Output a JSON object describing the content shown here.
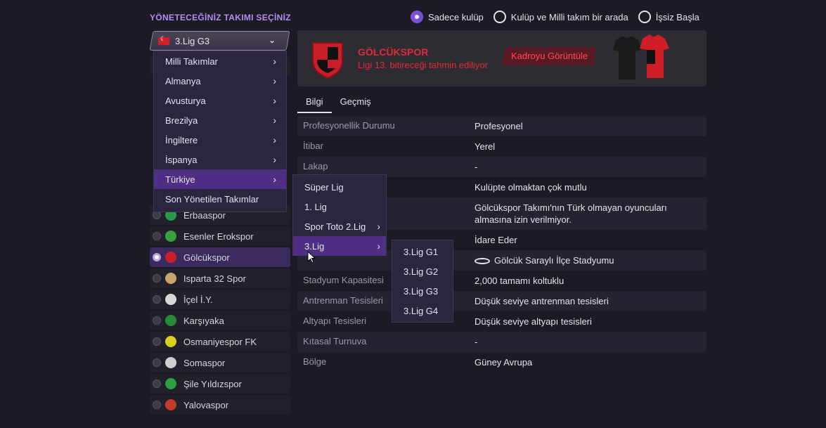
{
  "heading": "YÖNETECEĞİNİZ TAKIMI SEÇİNİZ",
  "radios": [
    {
      "label": "Sadece kulüp",
      "selected": true
    },
    {
      "label": "Kulüp ve Milli takım bir arada",
      "selected": false
    },
    {
      "label": "İşsiz Başla",
      "selected": false
    }
  ],
  "dropdown": {
    "value": "3.Lig G3"
  },
  "menu_level1": [
    {
      "label": "Milli Takımlar"
    },
    {
      "label": "Almanya"
    },
    {
      "label": "Avusturya"
    },
    {
      "label": "Brezilya"
    },
    {
      "label": "İngiltere"
    },
    {
      "label": "İspanya"
    },
    {
      "label": "Türkiye"
    },
    {
      "label": "Son Yönetilen Takımlar"
    }
  ],
  "menu_level2": [
    {
      "label": "Süper Lig"
    },
    {
      "label": "1. Lig"
    },
    {
      "label": "Spor Toto 2.Lig"
    },
    {
      "label": "3.Lig"
    }
  ],
  "menu_level3": [
    {
      "label": "3.Lig G1"
    },
    {
      "label": "3.Lig G2"
    },
    {
      "label": "3.Lig G3"
    },
    {
      "label": "3.Lig G4"
    }
  ],
  "teams": [
    {
      "name": "Erbaaspor",
      "color": "#2a9a4a"
    },
    {
      "name": "Esenler Erokspor",
      "color": "#3aa03a"
    },
    {
      "name": "Gölcükspor",
      "color": "#c81e2a"
    },
    {
      "name": "Isparta 32 Spor",
      "color": "#c9a36a"
    },
    {
      "name": "İçel İ.Y.",
      "color": "#d8d8d8"
    },
    {
      "name": "Karşıyaka",
      "color": "#2a8a3a"
    },
    {
      "name": "Osmaniyespor FK",
      "color": "#d8d020"
    },
    {
      "name": "Somaspor",
      "color": "#cfcfcf"
    },
    {
      "name": "Şile Yıldızspor",
      "color": "#2aa040"
    },
    {
      "name": "Yalovaspor",
      "color": "#c83a2a"
    }
  ],
  "selected_team": "Gölcükspor",
  "banner": {
    "name": "GÖLCÜKSPOR",
    "prediction": "Ligi 13. bitireceği tahmin ediliyor",
    "squad_button": "Kadroyu Görüntüle"
  },
  "tabs": [
    {
      "label": "Bilgi",
      "active": true
    },
    {
      "label": "Geçmiş",
      "active": false
    }
  ],
  "info": [
    {
      "key": "Profesyonellik Durumu",
      "value": "Profesyonel"
    },
    {
      "key": "İtibar",
      "value": "Yerel"
    },
    {
      "key": "Lakap",
      "value": "-"
    },
    {
      "key": "",
      "value": "Kulüpte olmaktan çok mutlu"
    },
    {
      "key": "",
      "value": "Gölcükspor Takımı'nın Türk olmayan oyuncuları almasına izin verilmiyor."
    },
    {
      "key": "",
      "value": "İdare Eder"
    },
    {
      "key": "",
      "value": "Gölcük Saraylı İlçe Stadyumu"
    },
    {
      "key": "Stadyum Kapasitesi",
      "value": "2,000 tamamı koltuklu"
    },
    {
      "key": "Antrenman Tesisleri",
      "value": "Düşük seviye antrenman tesisleri"
    },
    {
      "key": "Altyapı Tesisleri",
      "value": "Düşük seviye altyapı tesisleri"
    },
    {
      "key": "Kıtasal Turnuva",
      "value": "-"
    },
    {
      "key": "Bölge",
      "value": "Güney Avrupa"
    }
  ]
}
